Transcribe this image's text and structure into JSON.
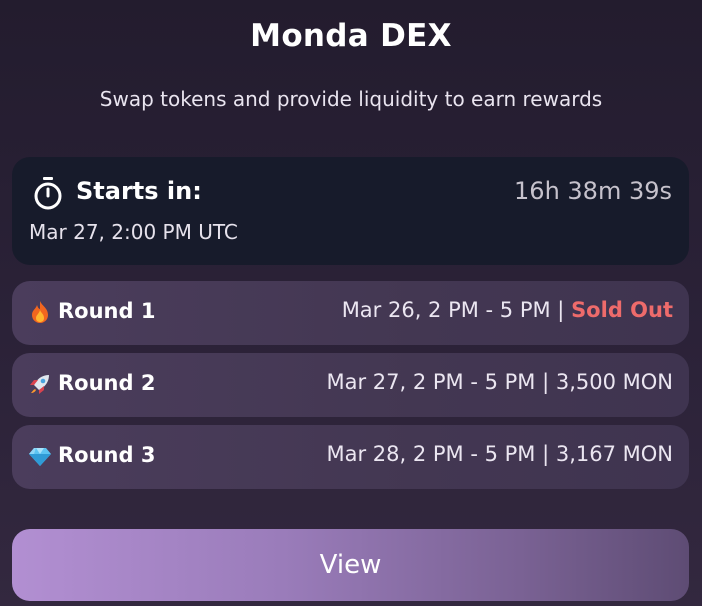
{
  "header": {
    "title": "Monda DEX",
    "subtitle": "Swap tokens and provide liquidity to earn rewards"
  },
  "start": {
    "icon": "stopwatch-icon",
    "label": "Starts in:",
    "countdown": "16h 38m 39s",
    "date": "Mar 27, 2:00 PM UTC"
  },
  "rounds": [
    {
      "icon": "fire-icon",
      "name": "Round 1",
      "time": "Mar 26, 2 PM - 5 PM",
      "separator": " | ",
      "status": "Sold Out"
    },
    {
      "icon": "rocket-icon",
      "name": "Round 2",
      "time": "Mar 27, 2 PM - 5 PM",
      "separator": " | ",
      "status": "3,500 MON"
    },
    {
      "icon": "gem-icon",
      "name": "Round 3",
      "time": "Mar 28, 2 PM - 5 PM",
      "separator": " | ",
      "status": "3,167 MON"
    }
  ],
  "action": {
    "view_label": "View"
  },
  "colors": {
    "sold_out": "#ee6b6b",
    "card_dark": "#171b2b",
    "button_start": "#b28fd2"
  }
}
